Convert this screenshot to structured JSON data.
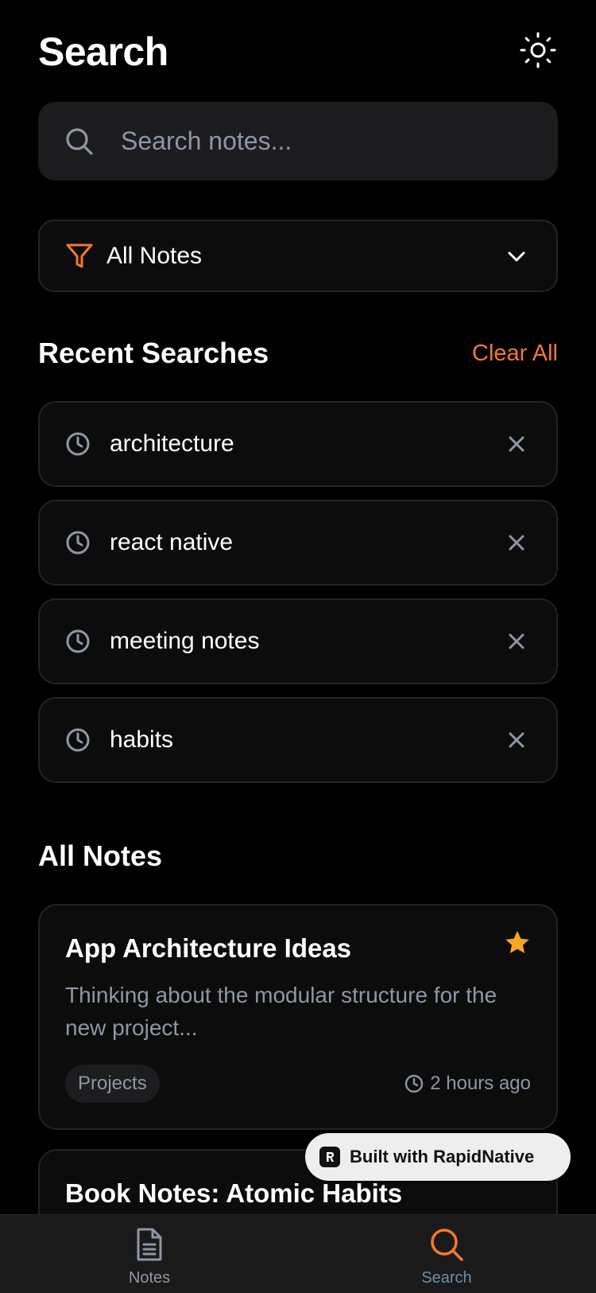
{
  "header": {
    "title": "Search",
    "theme_icon": "sun-icon"
  },
  "search": {
    "placeholder": "Search notes...",
    "value": ""
  },
  "filter": {
    "selected": "All Notes",
    "icon": "filter-icon"
  },
  "recent": {
    "title": "Recent Searches",
    "clear_label": "Clear All",
    "items": [
      {
        "label": "architecture"
      },
      {
        "label": "react native"
      },
      {
        "label": "meeting notes"
      },
      {
        "label": "habits"
      }
    ]
  },
  "notes": {
    "title": "All Notes",
    "items": [
      {
        "title": "App Architecture Ideas",
        "excerpt": "Thinking about the modular structure for the new project...",
        "tag": "Projects",
        "time": "2 hours ago",
        "starred": true
      },
      {
        "title": "Book Notes: Atomic Habits"
      }
    ]
  },
  "badge": {
    "label": "Built with RapidNative"
  },
  "tabs": [
    {
      "label": "Notes",
      "icon": "document-icon",
      "active": false
    },
    {
      "label": "Search",
      "icon": "search-icon",
      "active": true
    }
  ],
  "colors": {
    "accent": "#f2792a",
    "star": "#f5a623",
    "muted": "#8e97a6",
    "background": "#000000",
    "surface": "#1c1c1e"
  }
}
